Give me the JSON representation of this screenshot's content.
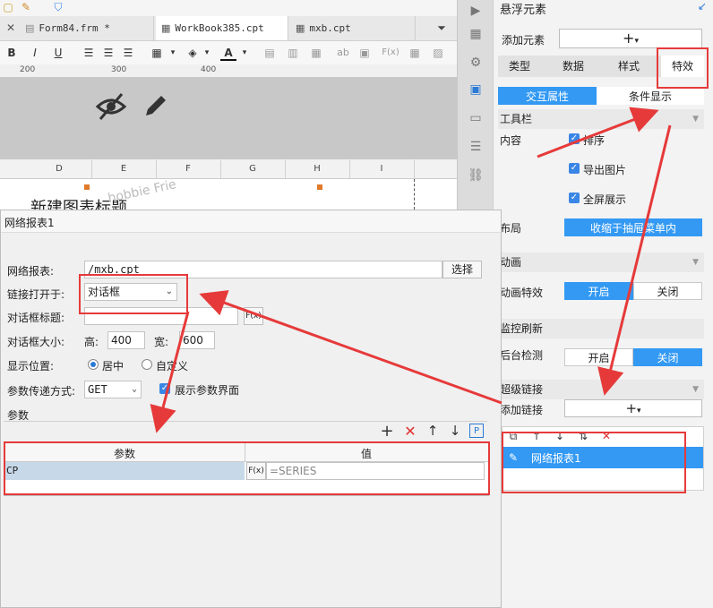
{
  "tabs": [
    {
      "label": "Form84.frm *"
    },
    {
      "label": "WorkBook385.cpt"
    },
    {
      "label": "mxb.cpt"
    }
  ],
  "format_bar": {
    "bold": "B",
    "italic": "I",
    "underline": "U",
    "text_color_glyph": "A",
    "formula": "F(x)",
    "ab_glyph": "ab"
  },
  "ruler": {
    "marks": [
      "200",
      "300",
      "400"
    ]
  },
  "columns": [
    "D",
    "E",
    "F",
    "G",
    "H",
    "I"
  ],
  "sheet": {
    "title_fragment": "新建图表标题",
    "watermark": "hobbie Frie"
  },
  "right_panel": {
    "title": "悬浮元素",
    "add_element_label": "添加元素",
    "add_btn": "+",
    "tabs": [
      "类型",
      "数据",
      "样式",
      "特效"
    ],
    "active_tab": "特效",
    "subtabs": [
      "交互属性",
      "条件显示"
    ],
    "toolbar_section": "工具栏",
    "content_label": "内容",
    "checkboxes": [
      "排序",
      "导出图片",
      "全屏展示"
    ],
    "layout_label": "布局",
    "layout_value": "收缩于抽屉菜单内",
    "animation_section": "动画",
    "animation_effect_label": "动画特效",
    "animation_on": "开启",
    "animation_off": "关闭",
    "monitor_section": "监控刷新",
    "bg_check_label": "后台检测",
    "bg_on": "开启",
    "bg_off": "关闭",
    "hyperlink_section": "超级链接",
    "add_link_label": "添加链接",
    "link_item": "网络报表1"
  },
  "dialog": {
    "title": "网络报表1",
    "report_label": "网络报表:",
    "report_value": "/mxb.cpt",
    "select_btn": "选择",
    "open_in_label": "链接打开于:",
    "open_in_value": "对话框",
    "dialog_title_label": "对话框标题:",
    "dialog_size_label": "对话框大小:",
    "height_label": "高:",
    "height_value": "400",
    "width_label": "宽:",
    "width_value": "600",
    "position_label": "显示位置:",
    "position_center": "居中",
    "position_custom": "自定义",
    "param_method_label": "参数传递方式:",
    "param_method_value": "GET",
    "show_param_label": "展示参数界面",
    "params_label": "参数",
    "table_headers": [
      "参数",
      "值"
    ],
    "rows": [
      {
        "param": "CP",
        "value": "=SERIES"
      }
    ],
    "formula_btn": "F(x)"
  },
  "colors": {
    "accent": "#3399f3",
    "highlight": "#e63a3a",
    "row_selected": "#c7d9e8"
  }
}
